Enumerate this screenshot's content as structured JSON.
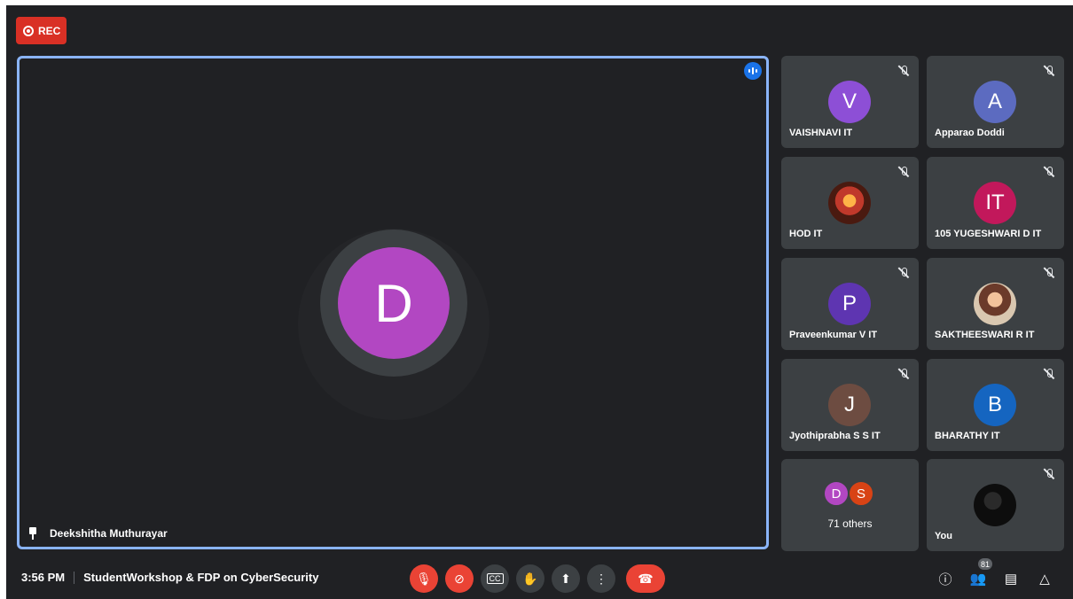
{
  "recording": {
    "label": "REC"
  },
  "main": {
    "name": "Deekshitha Muthurayar",
    "initial": "D",
    "avatar_color": "#b247c2"
  },
  "tiles": [
    {
      "name": "VAISHNAVI IT",
      "initial": "V",
      "color": "#8d4fd6"
    },
    {
      "name": "Apparao Doddi",
      "initial": "A",
      "color": "#5c6bc0"
    },
    {
      "name": "HOD IT",
      "initial": "",
      "color": "",
      "photo": "goddess-photo"
    },
    {
      "name": "105 YUGESHWARI D IT",
      "initial": "IT",
      "color": "#c2185b"
    },
    {
      "name": "Praveenkumar V IT",
      "initial": "P",
      "color": "#5e35b1"
    },
    {
      "name": "SAKTHEESWARI R IT",
      "initial": "",
      "color": "",
      "photo": "person-photo"
    },
    {
      "name": "Jyothiprabha S S IT",
      "initial": "J",
      "color": "#6d4c41"
    },
    {
      "name": "BHARATHY IT",
      "initial": "B",
      "color": "#1565c0"
    }
  ],
  "others": {
    "label": "71 others",
    "initials": [
      "D",
      "S"
    ],
    "colors": [
      "#b247c2",
      "#d84315"
    ]
  },
  "you": {
    "name": "You"
  },
  "bottom": {
    "time": "3:56 PM",
    "meeting_title": "StudentWorkshop & FDP on CyberSecurity",
    "participants_count": "81"
  },
  "icons": {
    "controls": [
      "mic-off-icon",
      "camera-off-icon",
      "captions-icon",
      "raise-hand-icon",
      "present-screen-icon",
      "more-options-icon",
      "end-call-icon"
    ],
    "right": [
      "info-icon",
      "people-icon",
      "chat-icon",
      "activities-icon"
    ]
  }
}
